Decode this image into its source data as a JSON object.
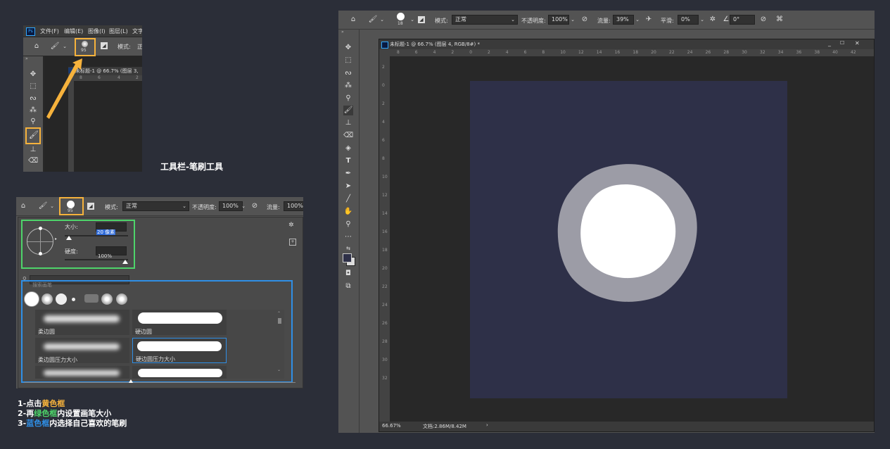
{
  "small": {
    "menu": [
      "文件(F)",
      "编辑(E)",
      "图像(I)",
      "图层(L)",
      "文字"
    ],
    "mode_label": "模式:",
    "mode_value": "正",
    "brush_size": "95",
    "doc_tab": "未标题-1 @ 66.7% (图层 3,",
    "ruler": [
      "8",
      "6",
      "4",
      "2"
    ]
  },
  "caption": "工具栏-笔刷工具",
  "panel": {
    "brush_size": "95",
    "mode_label": "模式:",
    "mode_value": "正常",
    "opacity_label": "不透明度:",
    "opacity_value": "100%",
    "flow_label": "流量:",
    "flow_value": "100%",
    "size_label": "大小:",
    "size_value": "20 像素",
    "hardness_label": "硬度:",
    "hardness_value": "100%",
    "search_placeholder": "搜索画笔",
    "brushes": [
      {
        "label": "柔边圆"
      },
      {
        "label": "硬边圆"
      },
      {
        "label": "柔边圆压力大小"
      },
      {
        "label": "硬边圆压力大小"
      }
    ]
  },
  "instructions": {
    "step1_pre": "1-点击",
    "step1_hl": "黄色框",
    "step2_pre": "2-再",
    "step2_hl": "绿色框",
    "step2_post": "内设置画笔大小",
    "step3_pre": "3-",
    "step3_hl": "蓝色框",
    "step3_post": "内选择自己喜欢的笔刷"
  },
  "colors": {
    "yellow": "#f6b23c",
    "green": "#4ed46a",
    "blue": "#2f8fe6",
    "canvas": "#2e3048"
  },
  "ps": {
    "brush_size": "18",
    "mode_label": "模式:",
    "mode_value": "正常",
    "opacity_label": "不透明度:",
    "opacity_value": "100%",
    "flow_label": "流量:",
    "flow_value": "39%",
    "smooth_label": "平滑:",
    "smooth_value": "0%",
    "angle_value": "0°",
    "doc_tab": "未标题-1 @ 66.7% (图层 4, RGB/8#) *",
    "ruler_top": [
      "8",
      "6",
      "4",
      "2",
      "0",
      "2",
      "4",
      "6",
      "8",
      "10",
      "12",
      "14",
      "16",
      "18",
      "20",
      "22",
      "24",
      "26",
      "28",
      "30",
      "32",
      "34",
      "36",
      "38",
      "40",
      "42"
    ],
    "ruler_left": [
      "2",
      "0",
      "2",
      "4",
      "6",
      "8",
      "10",
      "12",
      "14",
      "16",
      "18",
      "20",
      "22",
      "24",
      "26",
      "28",
      "30",
      "32"
    ],
    "zoom": "66.67%",
    "doc_info": "文档:2.86M/8.42M"
  }
}
